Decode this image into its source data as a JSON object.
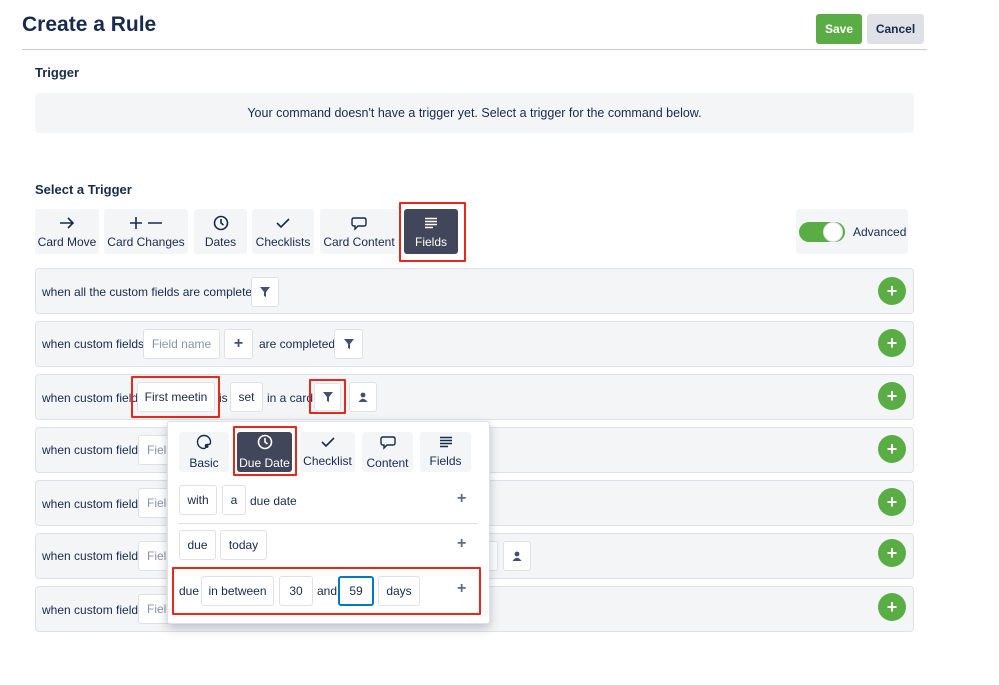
{
  "header": {
    "title": "Create a Rule",
    "save_label": "Save",
    "cancel_label": "Cancel"
  },
  "trigger": {
    "heading": "Trigger",
    "empty_message": "Your command doesn't have a trigger yet. Select a trigger for the command below."
  },
  "select_trigger": {
    "heading": "Select a Trigger",
    "tabs": [
      {
        "label": "Card Move",
        "icon": "arrow-right-icon"
      },
      {
        "label": "Card Changes",
        "icon": "plus-minus-icon"
      },
      {
        "label": "Dates",
        "icon": "clock-icon"
      },
      {
        "label": "Checklists",
        "icon": "checkmark-icon"
      },
      {
        "label": "Card Content",
        "icon": "speech-bubble-icon"
      },
      {
        "label": "Fields",
        "icon": "lines-icon",
        "active": true
      }
    ],
    "advanced_label": "Advanced",
    "advanced_on": true
  },
  "rows": {
    "r1": {
      "text": "when all the custom fields are completed"
    },
    "r2": {
      "text_a": "when custom fields",
      "field_placeholder": "Field name",
      "text_b": "are completed"
    },
    "r3": {
      "text_a": "when custom field",
      "field_value": "First meetin",
      "text_b": "is",
      "state": "set",
      "text_c": "in a card"
    },
    "r4": {
      "text_a": "when custom field",
      "field_fragment": "Field"
    },
    "r5": {
      "text_a": "when custom field",
      "field_fragment": "Field"
    },
    "r6": {
      "text_a": "when custom field",
      "field_fragment": "Field"
    },
    "r7": {
      "text_a": "when custom field",
      "field_fragment": "Field"
    }
  },
  "popup": {
    "tabs": [
      {
        "label": "Basic",
        "icon": "palette-icon"
      },
      {
        "label": "Due Date",
        "icon": "clock-icon",
        "active": true
      },
      {
        "label": "Checklist",
        "icon": "checkmark-icon"
      },
      {
        "label": "Content",
        "icon": "speech-bubble-icon"
      },
      {
        "label": "Fields",
        "icon": "lines-icon"
      }
    ],
    "line1": {
      "chip_a": "with",
      "chip_b": "a",
      "text": "due date"
    },
    "line2": {
      "chip_a": "due",
      "chip_b": "today"
    },
    "line3": {
      "text_a": "due",
      "chip_a": "in between",
      "chip_b": "30",
      "text_b": "and",
      "chip_c": "59",
      "chip_d": "days"
    }
  },
  "colors": {
    "accent_green": "#5aac44",
    "active_tab": "#42465a",
    "highlight_red": "#e8281c",
    "focus_blue": "#0079bf"
  }
}
